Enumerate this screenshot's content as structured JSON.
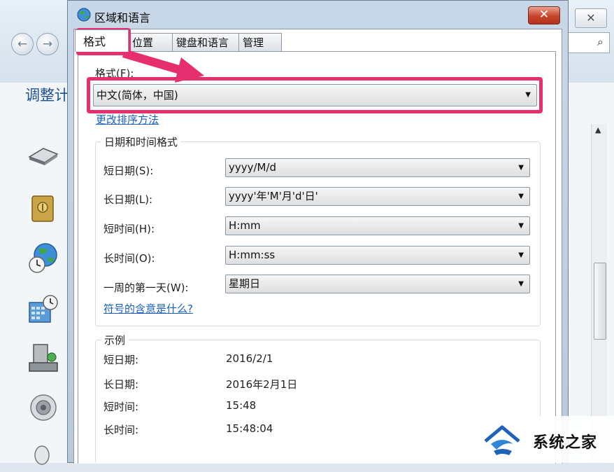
{
  "background_window": {
    "heading": "调整计",
    "search_icon": "magnifier-icon",
    "close_glyph": "✕",
    "side_icons": [
      "keyboard-icon",
      "safe-icon",
      "globe-clock-icon",
      "calendar-icon",
      "computer-icon",
      "speaker-icon",
      "mouse-icon"
    ]
  },
  "dialog": {
    "title": "区域和语言",
    "close_glyph": "✕",
    "tabs": [
      "格式",
      "位置",
      "键盘和语言",
      "管理"
    ],
    "format": {
      "label": "格式(F):",
      "value": "中文(简体，中国)",
      "sort_link": "更改排序方法"
    },
    "datetime": {
      "group_title": "日期和时间格式",
      "rows": [
        {
          "label": "短日期(S):",
          "value": "yyyy/M/d"
        },
        {
          "label": "长日期(L):",
          "value": "yyyy'年'M'月'd'日'"
        },
        {
          "label": "短时间(H):",
          "value": "H:mm"
        },
        {
          "label": "长时间(O):",
          "value": "H:mm:ss"
        },
        {
          "label": "一周的第一天(W):",
          "value": "星期日"
        }
      ],
      "help_link": "符号的含意是什么?"
    },
    "examples": {
      "group_title": "示例",
      "rows": [
        {
          "label": "短日期:",
          "value": "2016/2/1"
        },
        {
          "label": "长日期:",
          "value": "2016年2月1日"
        },
        {
          "label": "短时间:",
          "value": "15:48"
        },
        {
          "label": "长时间:",
          "value": "15:48:04"
        }
      ]
    }
  },
  "annotation": {
    "color": "#e62f6e"
  },
  "watermark": {
    "text": "系统之家"
  }
}
